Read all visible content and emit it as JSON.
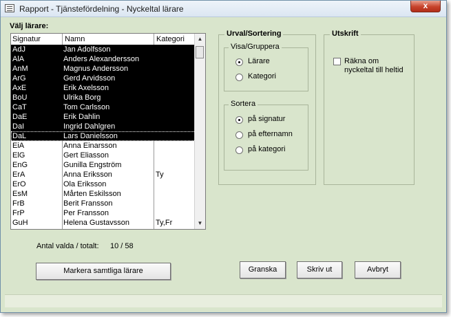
{
  "window": {
    "title": "Rapport - Tjänstefördelning - Nyckeltal lärare",
    "close_label": "x"
  },
  "teachers": {
    "label": "Välj lärare:",
    "columns": [
      "Signatur",
      "Namn",
      "Kategori"
    ],
    "rows": [
      {
        "sig": "AdJ",
        "name": "Jan Adolfsson",
        "cat": "",
        "selected": true
      },
      {
        "sig": "AlA",
        "name": "Anders Alexandersson",
        "cat": "",
        "selected": true
      },
      {
        "sig": "AnM",
        "name": "Magnus Andersson",
        "cat": "",
        "selected": true
      },
      {
        "sig": "ArG",
        "name": "Gerd Arvidsson",
        "cat": "",
        "selected": true
      },
      {
        "sig": "AxE",
        "name": "Erik Axelsson",
        "cat": "",
        "selected": true
      },
      {
        "sig": "BoU",
        "name": "Ulrika Borg",
        "cat": "",
        "selected": true
      },
      {
        "sig": "CaT",
        "name": "Tom Carlsson",
        "cat": "",
        "selected": true
      },
      {
        "sig": "DaE",
        "name": "Erik Dahlin",
        "cat": "",
        "selected": true
      },
      {
        "sig": "DaI",
        "name": "Ingrid Dahlgren",
        "cat": "",
        "selected": true
      },
      {
        "sig": "DaL",
        "name": "Lars Danielsson",
        "cat": "",
        "selected": true
      },
      {
        "sig": "EiA",
        "name": "Anna Einarsson",
        "cat": "",
        "selected": false
      },
      {
        "sig": "ElG",
        "name": "Gert Eliasson",
        "cat": "",
        "selected": false
      },
      {
        "sig": "EnG",
        "name": "Gunilla Engström",
        "cat": "",
        "selected": false
      },
      {
        "sig": "ErA",
        "name": "Anna Eriksson",
        "cat": "Ty",
        "selected": false
      },
      {
        "sig": "ErO",
        "name": "Ola Eriksson",
        "cat": "",
        "selected": false
      },
      {
        "sig": "EsM",
        "name": "Mårten Eskilsson",
        "cat": "",
        "selected": false
      },
      {
        "sig": "FrB",
        "name": "Berit Fransson",
        "cat": "",
        "selected": false
      },
      {
        "sig": "FrP",
        "name": "Per Fransson",
        "cat": "",
        "selected": false
      },
      {
        "sig": "GuH",
        "name": "Helena Gustavsson",
        "cat": "Ty,Fr",
        "selected": false
      }
    ],
    "count_label": "Antal valda / totalt:",
    "count_value": "10 / 58",
    "mark_all_button": "Markera samtliga lärare"
  },
  "urval": {
    "title": "Urval/Sortering",
    "visa_title": "Visa/Gruppera",
    "visa_options": [
      "Lärare",
      "Kategori"
    ],
    "visa_selected": 0,
    "sortera_title": "Sortera",
    "sortera_options": [
      "på signatur",
      "på efternamn",
      "på kategori"
    ],
    "sortera_selected": 0
  },
  "utskrift": {
    "title": "Utskrift",
    "checkbox_line1": "Räkna om",
    "checkbox_line2": "nyckeltal till heltid",
    "checked": false
  },
  "buttons": {
    "preview": "Granska",
    "print": "Skriv ut",
    "cancel": "Avbryt"
  },
  "colors": {
    "background": "#d9e5cc",
    "selection": "#000000",
    "close_button": "#c7432b"
  }
}
